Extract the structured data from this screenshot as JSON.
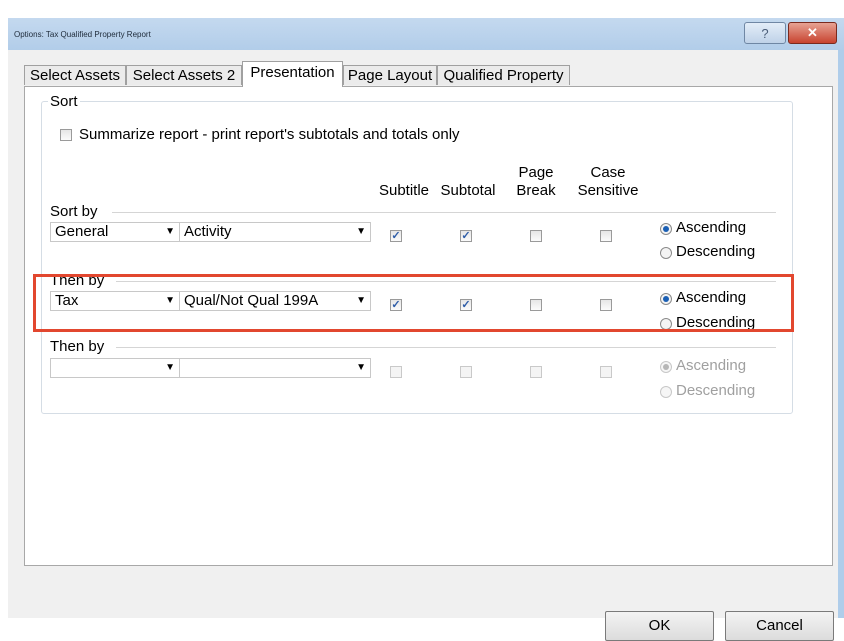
{
  "window": {
    "title": "Options: Tax Qualified Property Report",
    "help_label": "?",
    "close_label": "✕"
  },
  "tabs": [
    {
      "label": "Select Assets"
    },
    {
      "label": "Select Assets 2"
    },
    {
      "label": "Presentation"
    },
    {
      "label": "Page Layout"
    },
    {
      "label": "Qualified Property"
    }
  ],
  "active_tab": "Presentation",
  "sort": {
    "legend": "Sort",
    "summarize_label": "Summarize report - print report's subtotals and totals only",
    "summarize_checked": false,
    "headers": {
      "subtitle": "Subtitle",
      "subtotal": "Subtotal",
      "page_break_1": "Page",
      "page_break_2": "Break",
      "case_1": "Case",
      "case_2": "Sensitive"
    },
    "rows": [
      {
        "label": "Sort by",
        "field1": "General",
        "field2": "Activity",
        "subtitle": true,
        "subtotal": true,
        "page_break": false,
        "case_sensitive": false,
        "ascending_label": "Ascending",
        "descending_label": "Descending",
        "order": "ascending",
        "enabled": true
      },
      {
        "label": "Then by",
        "field1": "Tax",
        "field2": "Qual/Not Qual 199A",
        "subtitle": true,
        "subtotal": true,
        "page_break": false,
        "case_sensitive": false,
        "ascending_label": "Ascending",
        "descending_label": "Descending",
        "order": "ascending",
        "enabled": true
      },
      {
        "label": "Then by",
        "field1": "",
        "field2": "",
        "subtitle": false,
        "subtotal": false,
        "page_break": false,
        "case_sensitive": false,
        "ascending_label": "Ascending",
        "descending_label": "Descending",
        "order": "ascending",
        "enabled": false
      }
    ]
  },
  "buttons": {
    "ok": "OK",
    "cancel": "Cancel"
  },
  "colors": {
    "highlight": "#e2472f",
    "titlebar": "#b8d1ec",
    "close": "#c8432f"
  },
  "arrow_glyph": "▼",
  "check_glyph": "✓"
}
